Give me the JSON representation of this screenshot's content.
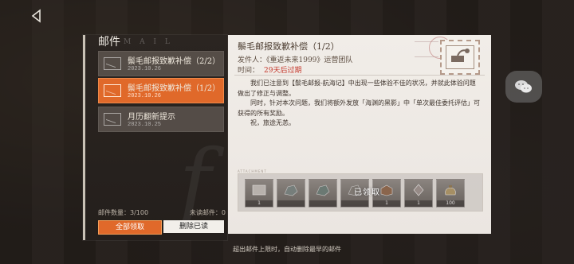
{
  "header": {
    "back_label": ""
  },
  "panel": {
    "title": "邮件",
    "subtitle": "M A I L",
    "items": [
      {
        "title": "鬃毛邮报致歉补偿（2/2）",
        "date": "2023.10.26",
        "state": "read"
      },
      {
        "title": "鬃毛邮报致歉补偿（1/2）",
        "date": "2023.10.26",
        "state": "active"
      },
      {
        "title": "月历翻新提示",
        "date": "2023.10.25",
        "state": "read"
      }
    ],
    "count_label": "邮件数量：3/100",
    "unread_label": "未读邮件：0",
    "receive_all": "全部领取",
    "delete_read": "删除已读"
  },
  "detail": {
    "title": "鬃毛邮报致歉补偿（1/2）",
    "sender": "发件人：《重返未来1999》运营团队",
    "time_label": "时间：",
    "time_value": "29天后过期",
    "paragraphs": [
      "我们已注意到【鬃毛邮报-航海记】中出现一些体验不佳的状况，并就此体验问题做出了修正与调整。",
      "同时，针对本次问题，我们将额外发放「海渊的黑影」中「单次最佳委托评估」可获得的所有奖励。",
      "祝，旅途无恙。"
    ],
    "attachment_label": "ATTACHMENT",
    "attachments": [
      {
        "icon": "crate-icon",
        "qty": "1"
      },
      {
        "icon": "ore-icon",
        "qty": ""
      },
      {
        "icon": "ore-icon",
        "qty": ""
      },
      {
        "icon": "ore-icon",
        "qty": ""
      },
      {
        "icon": "block-icon",
        "qty": "1"
      },
      {
        "icon": "crystal-icon",
        "qty": "1"
      },
      {
        "icon": "coin-bag-icon",
        "qty": "100"
      }
    ],
    "received_label": "已领取"
  },
  "footer": {
    "hint": "超出邮件上限时，自动删除最早的邮件"
  },
  "colors": {
    "accent": "#e0692a",
    "expire": "#c4372b"
  }
}
